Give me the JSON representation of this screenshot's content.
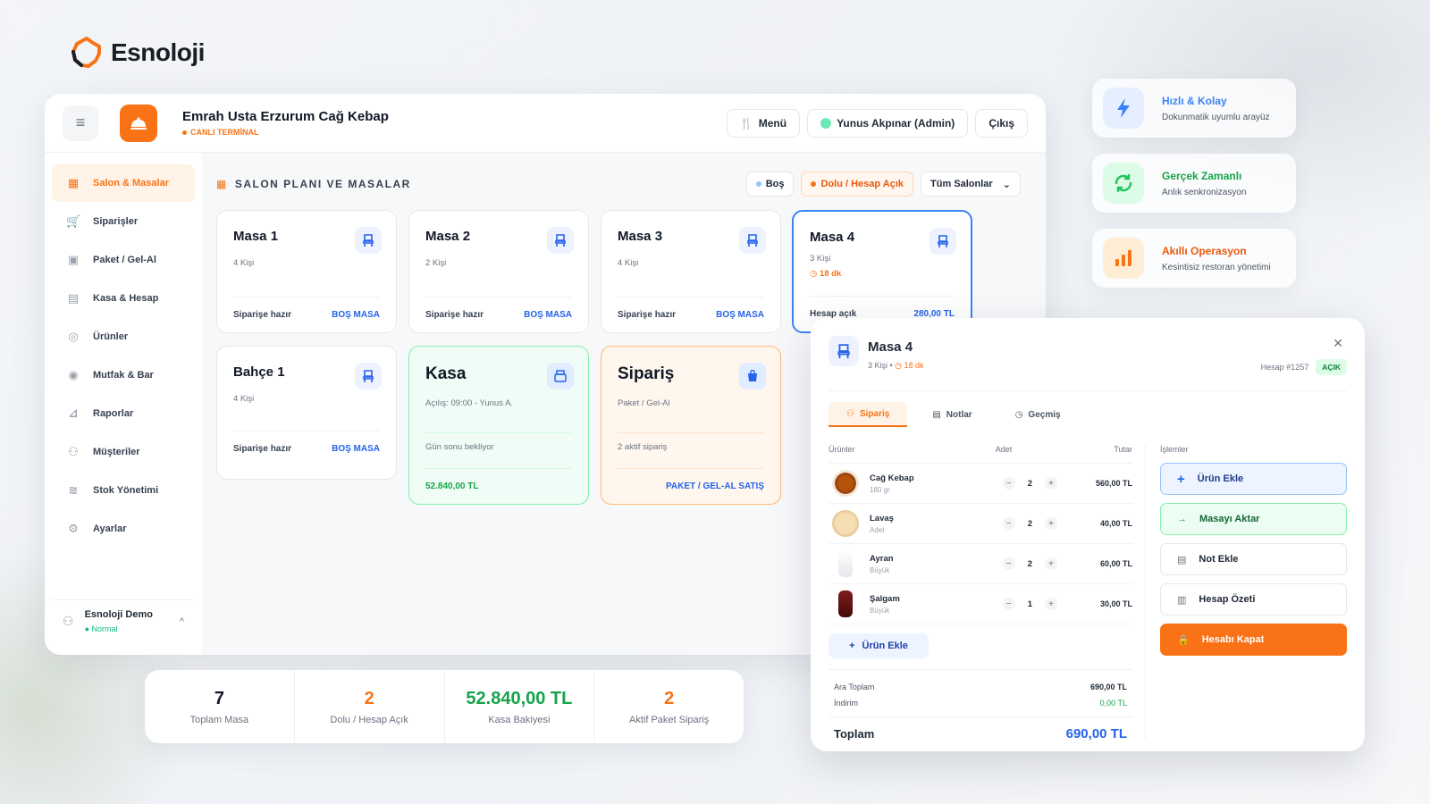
{
  "brand": {
    "name": "Esnoloji"
  },
  "header": {
    "restaurant": "Emrah Usta Erzurum Cağ Kebap",
    "live_label": "CANLI TERMİNAL",
    "menu_label": "Menü",
    "user_label": "Yunus Akpınar (Admin)",
    "logout_label": "Çıkış"
  },
  "sidebar": {
    "items": [
      {
        "label": "Salon & Masalar",
        "icon": "grid-icon"
      },
      {
        "label": "Siparişler",
        "icon": "cart-icon"
      },
      {
        "label": "Paket / Gel-Al",
        "icon": "package-icon"
      },
      {
        "label": "Kasa & Hesap",
        "icon": "register-icon"
      },
      {
        "label": "Ürünler",
        "icon": "products-icon"
      },
      {
        "label": "Mutfak & Bar",
        "icon": "kitchen-icon"
      },
      {
        "label": "Raporlar",
        "icon": "chart-icon"
      },
      {
        "label": "Müşteriler",
        "icon": "users-icon"
      },
      {
        "label": "Stok Yönetimi",
        "icon": "layers-icon"
      },
      {
        "label": "Ayarlar",
        "icon": "gear-icon"
      }
    ],
    "user_name": "Esnoloji Demo",
    "user_status": "Normal"
  },
  "main": {
    "section_title": "SALON PLANI VE MASALAR",
    "filter_empty": "Boş",
    "filter_busy": "Dolu / Hesap Açık",
    "filter_select": "Tüm Salonlar"
  },
  "tables": [
    {
      "title": "Masa 1",
      "sub": "4 Kişi",
      "left": "Siparişe hazır",
      "right": "BOŞ MASA"
    },
    {
      "title": "Masa 2",
      "sub": "2 Kişi",
      "left": "Siparişe hazır",
      "right": "BOŞ MASA"
    },
    {
      "title": "Masa 3",
      "sub": "4 Kişi",
      "left": "Siparişe hazır",
      "right": "BOŞ MASA"
    },
    {
      "title": "Masa 4",
      "sub": "3 Kişi",
      "time": "18 dk",
      "left": "Hesap açık",
      "right": "280,00 TL"
    },
    {
      "title": "Bahçe 1",
      "sub": "4 Kişi",
      "left": "Siparişe hazır",
      "right": "BOŞ MASA"
    }
  ],
  "kasa": {
    "title": "Kasa",
    "sub": "Açılış: 09:00 - Yunus A.",
    "note": "Gün sonu bekliyor",
    "amount": "52.840,00 TL"
  },
  "siparis": {
    "title": "Sipariş",
    "sub": "Paket / Gel-Al",
    "note": "2 aktif sipariş",
    "action": "PAKET / GEL-AL SATIŞ"
  },
  "stats": [
    {
      "value": "7",
      "label": "Toplam Masa"
    },
    {
      "value": "2",
      "label": "Dolu / Hesap Açık"
    },
    {
      "value": "52.840,00 TL",
      "label": "Kasa Bakiyesi"
    },
    {
      "value": "2",
      "label": "Aktif Paket Sipariş"
    }
  ],
  "features": [
    {
      "title": "Hızlı & Kolay",
      "sub": "Dokunmatik uyumlu arayüz",
      "color": "#3b82f6"
    },
    {
      "title": "Gerçek Zamanlı",
      "sub": "Anlık senkronizasyon",
      "color": "#22c55e"
    },
    {
      "title": "Akıllı Operasyon",
      "sub": "Kesintisiz restoran yönetimi",
      "color": "#f97316"
    }
  ],
  "panel": {
    "title": "Masa 4",
    "people": "3 Kişi",
    "time": "18 dk",
    "account": "Hesap #1257",
    "status": "AÇIK",
    "tabs": [
      "Sipariş",
      "Notlar",
      "Geçmiş"
    ],
    "col_products": "Ürünler",
    "col_qty": "Adet",
    "col_total": "Tutar",
    "items": [
      {
        "name": "Cağ Kebap",
        "sub": "180 gr.",
        "qty": "2",
        "total": "560,00 TL"
      },
      {
        "name": "Lavaş",
        "sub": "Adet",
        "qty": "2",
        "total": "40,00 TL"
      },
      {
        "name": "Ayran",
        "sub": "Büyük",
        "qty": "2",
        "total": "60,00 TL"
      },
      {
        "name": "Şalgam",
        "sub": "Büyük",
        "qty": "1",
        "total": "30,00 TL"
      }
    ],
    "add_product": "Ürün Ekle",
    "subtotal_label": "Ara Toplam",
    "subtotal": "690,00 TL",
    "discount_label": "İndirim",
    "discount": "0,00 TL",
    "total_label": "Toplam",
    "total": "690,00 TL",
    "ops_title": "İşlemler",
    "ops": [
      "Ürün Ekle",
      "Masayı Aktar",
      "Not Ekle",
      "Hesap Özeti",
      "Hesabı Kapat"
    ]
  }
}
